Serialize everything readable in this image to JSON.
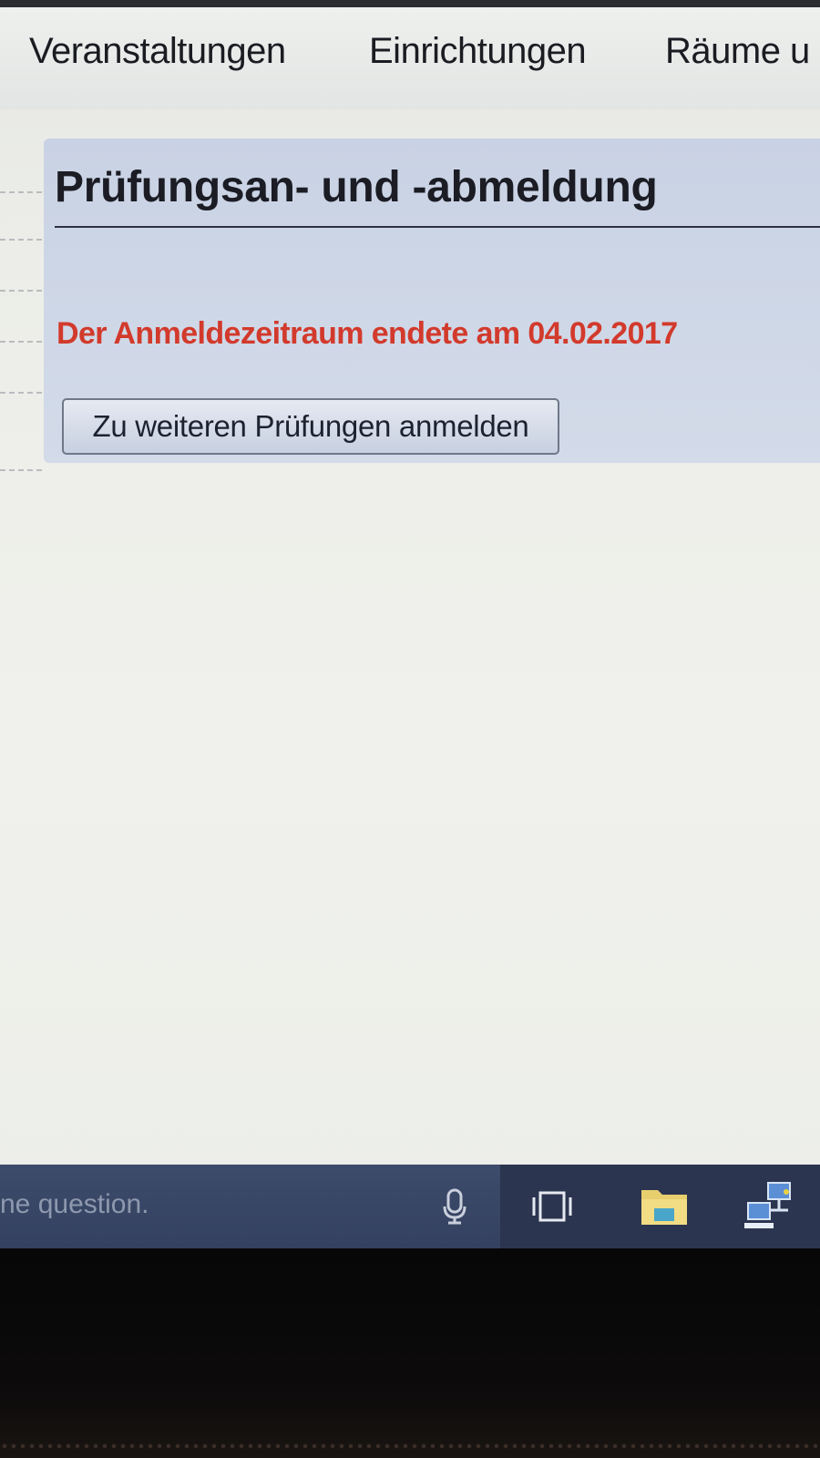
{
  "nav": {
    "items": [
      {
        "label": "Veranstaltungen"
      },
      {
        "label": "Einrichtungen"
      },
      {
        "label": "Räume u"
      }
    ]
  },
  "panel": {
    "title": "Prüfungsan- und -abmeldung",
    "message": "Der Anmeldezeitraum endete am 04.02.2017",
    "button_label": "Zu weiteren Prüfungen anmelden"
  },
  "taskbar": {
    "search_placeholder": "ne question.",
    "icons": [
      "microphone-icon",
      "task-view-icon",
      "file-explorer-icon",
      "network-icon"
    ]
  },
  "colors": {
    "message": "#d23a2c",
    "panel_bg": "#cdd6e6",
    "taskbar": "#2b3550"
  }
}
